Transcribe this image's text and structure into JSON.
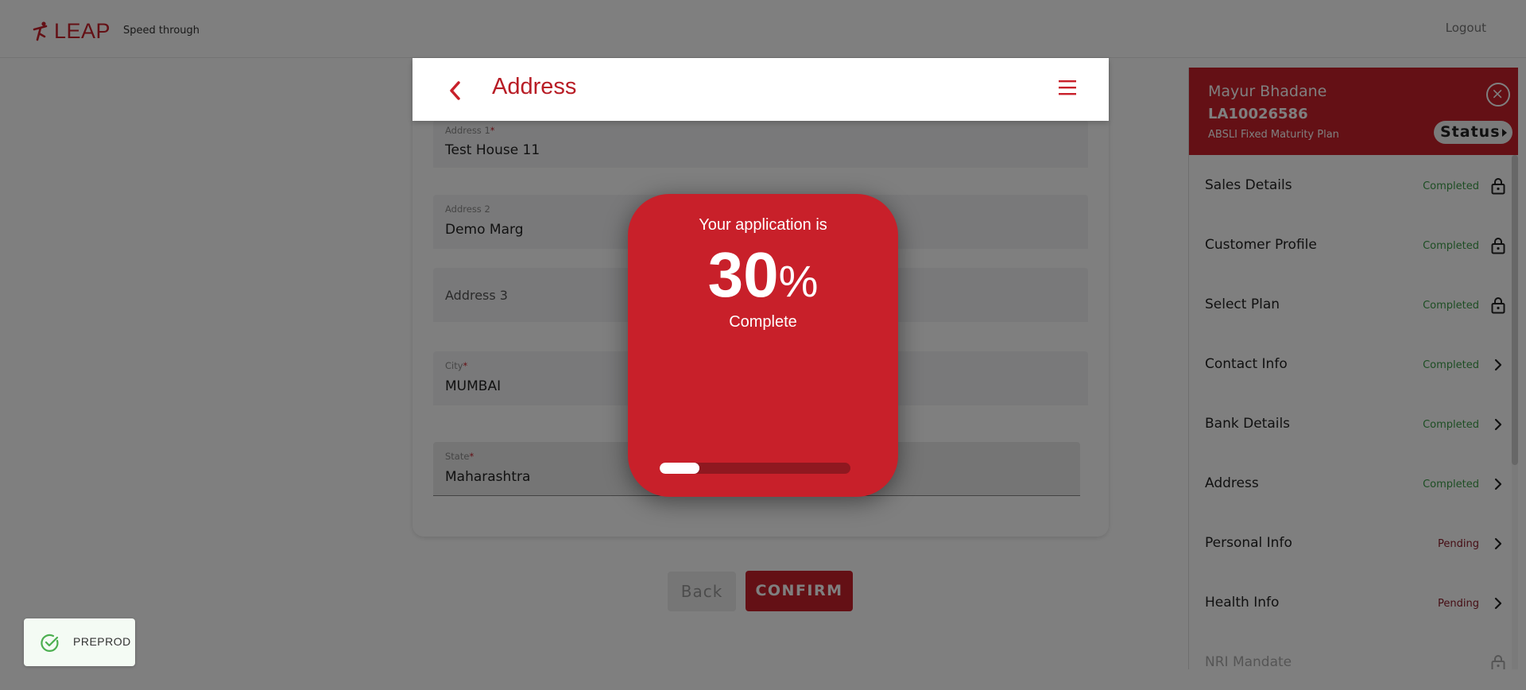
{
  "header": {
    "brand": "LEAP",
    "tagline": "Speed through",
    "logout_label": "Logout"
  },
  "form": {
    "title": "Address",
    "fields": [
      {
        "label": "Address 1",
        "required": true,
        "value": "Test House 11",
        "placeholder": ""
      },
      {
        "label": "Address 2",
        "required": false,
        "value": "Demo Marg",
        "placeholder": ""
      },
      {
        "label": "",
        "required": false,
        "value": "",
        "placeholder": "Address 3"
      },
      {
        "label": "City",
        "required": true,
        "value": "MUMBAI",
        "placeholder": ""
      },
      {
        "label": "State",
        "required": true,
        "value": "Maharashtra",
        "placeholder": ""
      }
    ],
    "required_mark": "*",
    "back_label": "Back",
    "confirm_label": "CONFIRM"
  },
  "status_panel": {
    "customer_name": "Mayur Bhadane",
    "application_id": "LA10026586",
    "plan_name": "ABSLI Fixed Maturity Plan",
    "status_label": "Status",
    "steps": [
      {
        "label": "Sales Details",
        "state": "Completed",
        "icon": "lock-icon"
      },
      {
        "label": "Customer Profile",
        "state": "Completed",
        "icon": "lock-icon"
      },
      {
        "label": "Select Plan",
        "state": "Completed",
        "icon": "lock-icon"
      },
      {
        "label": "Contact Info",
        "state": "Completed",
        "icon": "chevron-right-icon"
      },
      {
        "label": "Bank Details",
        "state": "Completed",
        "icon": "chevron-right-icon"
      },
      {
        "label": "Address",
        "state": "Completed",
        "icon": "chevron-right-icon"
      },
      {
        "label": "Personal Info",
        "state": "Pending",
        "icon": "chevron-right-icon"
      },
      {
        "label": "Health Info",
        "state": "Pending",
        "icon": "chevron-right-icon"
      },
      {
        "label": "NRI Mandate",
        "state": "",
        "icon": "lock-icon"
      }
    ]
  },
  "progress_modal": {
    "line1": "Your application is",
    "percent_number": "30",
    "percent_sign": "%",
    "line2": "Complete",
    "progress_fraction": 0.21
  },
  "env_badge": {
    "label": "PREPROD"
  },
  "colors": {
    "brand_red": "#c8202a",
    "completed_green": "#3a9b47",
    "pending_red": "#8b1a28"
  }
}
